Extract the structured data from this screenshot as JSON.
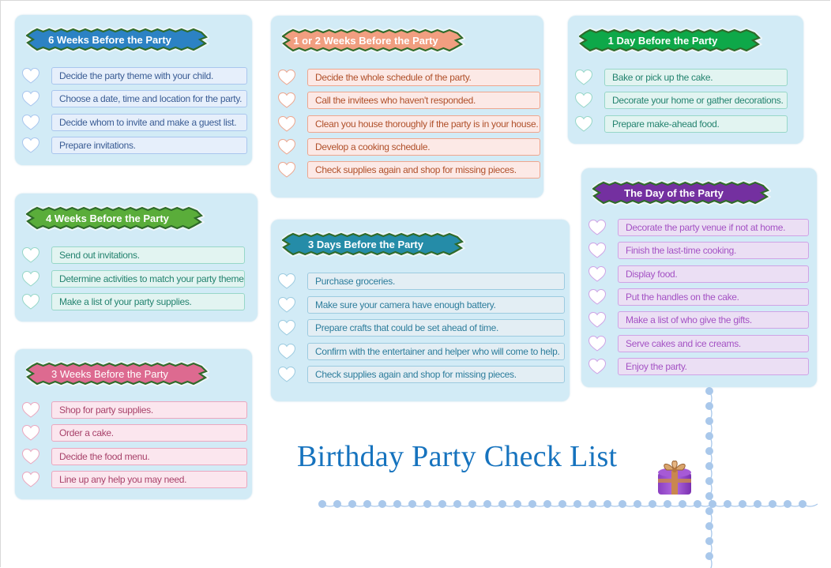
{
  "title": "Birthday Party Check List",
  "colors": {
    "card_bg": "#d2ebf6",
    "title": "#1673be",
    "bead": "#a9c8eb"
  },
  "sections": [
    {
      "id": "six-weeks",
      "heading": "6 Weeks Before the Party",
      "banner_color": "#2c82c4",
      "item_bg": "#e6effb",
      "item_border": "#a9c6ee",
      "text_color": "#3a5c94",
      "items": [
        "Decide the party theme with your child.",
        "Choose a date, time and location for the party.",
        "Decide whom to invite and make a guest list.",
        "Prepare invitations."
      ]
    },
    {
      "id": "one-two-weeks",
      "heading": "1 or 2 Weeks Before the Party",
      "banner_color": "#f19e80",
      "item_bg": "#fce9e6",
      "item_border": "#eea68e",
      "text_color": "#b0502a",
      "items": [
        "Decide the whole schedule of the party.",
        "Call the invitees who haven't responded.",
        "Clean you house thoroughly if the party is in your house.",
        "Develop a cooking schedule.",
        "Check supplies again and shop for missing pieces."
      ]
    },
    {
      "id": "one-day",
      "heading": "1 Day Before the Party",
      "banner_color": "#0ea849",
      "item_bg": "#e2f4f1",
      "item_border": "#97d7c8",
      "text_color": "#24836f",
      "items": [
        "Bake or pick up the cake.",
        "Decorate your home or gather decorations.",
        "Prepare make-ahead food."
      ]
    },
    {
      "id": "four-weeks",
      "heading": "4 Weeks Before the Party",
      "banner_color": "#5aad3a",
      "item_bg": "#e2f4f1",
      "item_border": "#97d7c8",
      "text_color": "#24836f",
      "items": [
        "Send out invitations.",
        "Determine activities to match your party theme.",
        "Make a list of your party supplies."
      ]
    },
    {
      "id": "three-days",
      "heading": "3 Days Before the Party",
      "banner_color": "#258ca8",
      "item_bg": "#e3eef4",
      "item_border": "#9ccbe0",
      "text_color": "#2d7d9c",
      "items": [
        "Purchase groceries.",
        "Make sure your camera have enough battery.",
        "Prepare crafts that could be set ahead of time.",
        "Confirm with the entertainer and helper who will come to help.",
        "Check supplies again and shop for missing pieces."
      ]
    },
    {
      "id": "day-of",
      "heading": "The Day of the Party",
      "banner_color": "#7430a0",
      "item_bg": "#ebdff4",
      "item_border": "#cfa3e6",
      "text_color": "#a452c4",
      "items": [
        "Decorate the party venue if not at home.",
        "Finish the last-time cooking.",
        "Display food.",
        "Put the handles on the cake.",
        "Make a list of who give the gifts.",
        "Serve cakes and ice creams.",
        "Enjoy the party."
      ]
    },
    {
      "id": "three-weeks",
      "heading": "3 Weeks Before the Party",
      "banner_color": "#dd6a90",
      "item_bg": "#fbe6ee",
      "item_border": "#eba7bf",
      "text_color": "#a8426a",
      "items": [
        "Shop for party supplies.",
        "Order a cake.",
        "Decide the food menu.",
        "Line up any help you may need."
      ]
    }
  ]
}
